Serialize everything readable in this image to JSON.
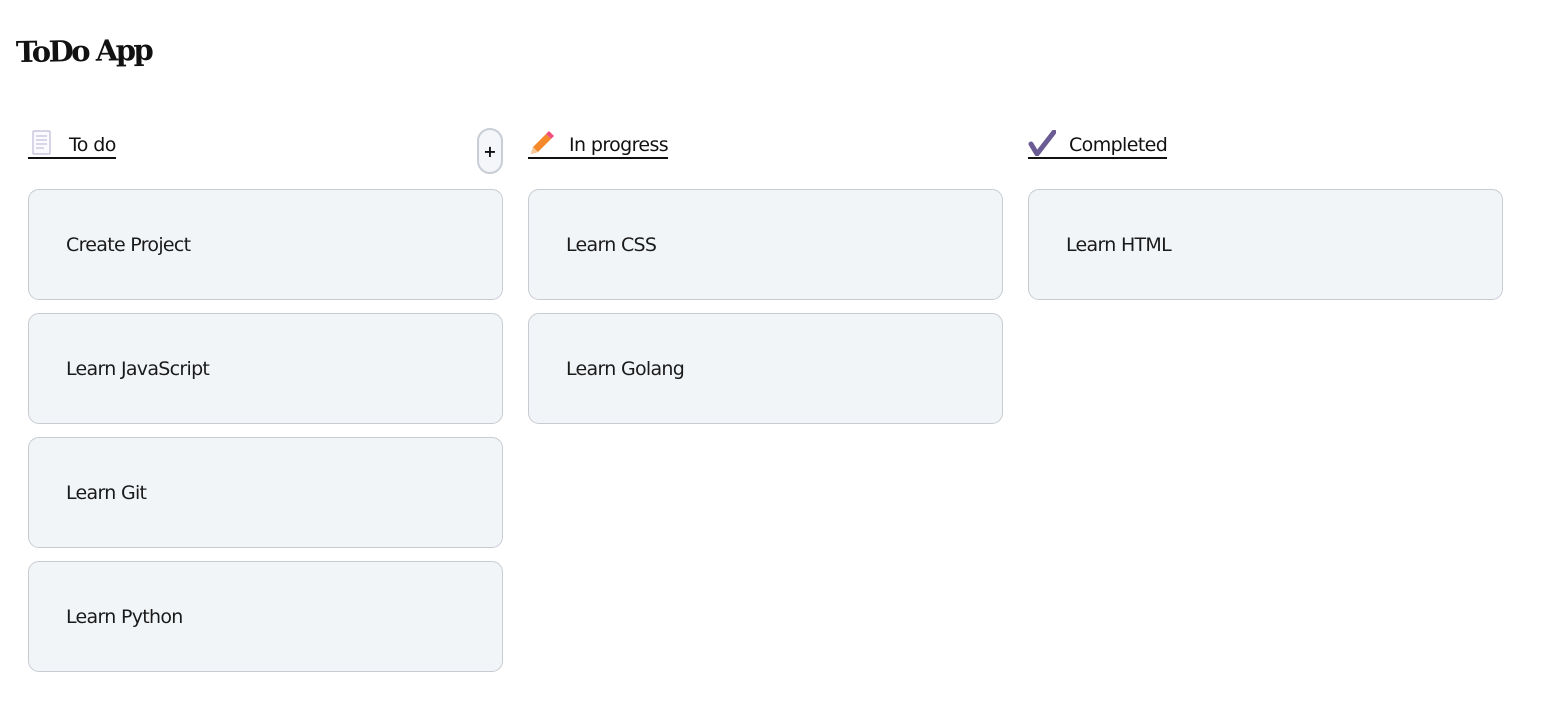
{
  "app": {
    "title": "ToDo App"
  },
  "columns": [
    {
      "id": "todo",
      "label": "To do",
      "icon": "memo-icon",
      "add_label": "+",
      "cards": [
        "Create Project",
        "Learn JavaScript",
        "Learn Git",
        "Learn Python"
      ]
    },
    {
      "id": "in-progress",
      "label": "In progress",
      "icon": "pencil-icon",
      "cards": [
        "Learn CSS",
        "Learn Golang"
      ]
    },
    {
      "id": "completed",
      "label": "Completed",
      "icon": "check-icon",
      "cards": [
        "Learn HTML"
      ]
    }
  ],
  "colors": {
    "card_background": "#f2f5f8",
    "card_border": "#c7ccd3",
    "pencil_orange": "#f48a2b",
    "pencil_pink": "#ef4f7a",
    "check_purple": "#6b5b95"
  }
}
